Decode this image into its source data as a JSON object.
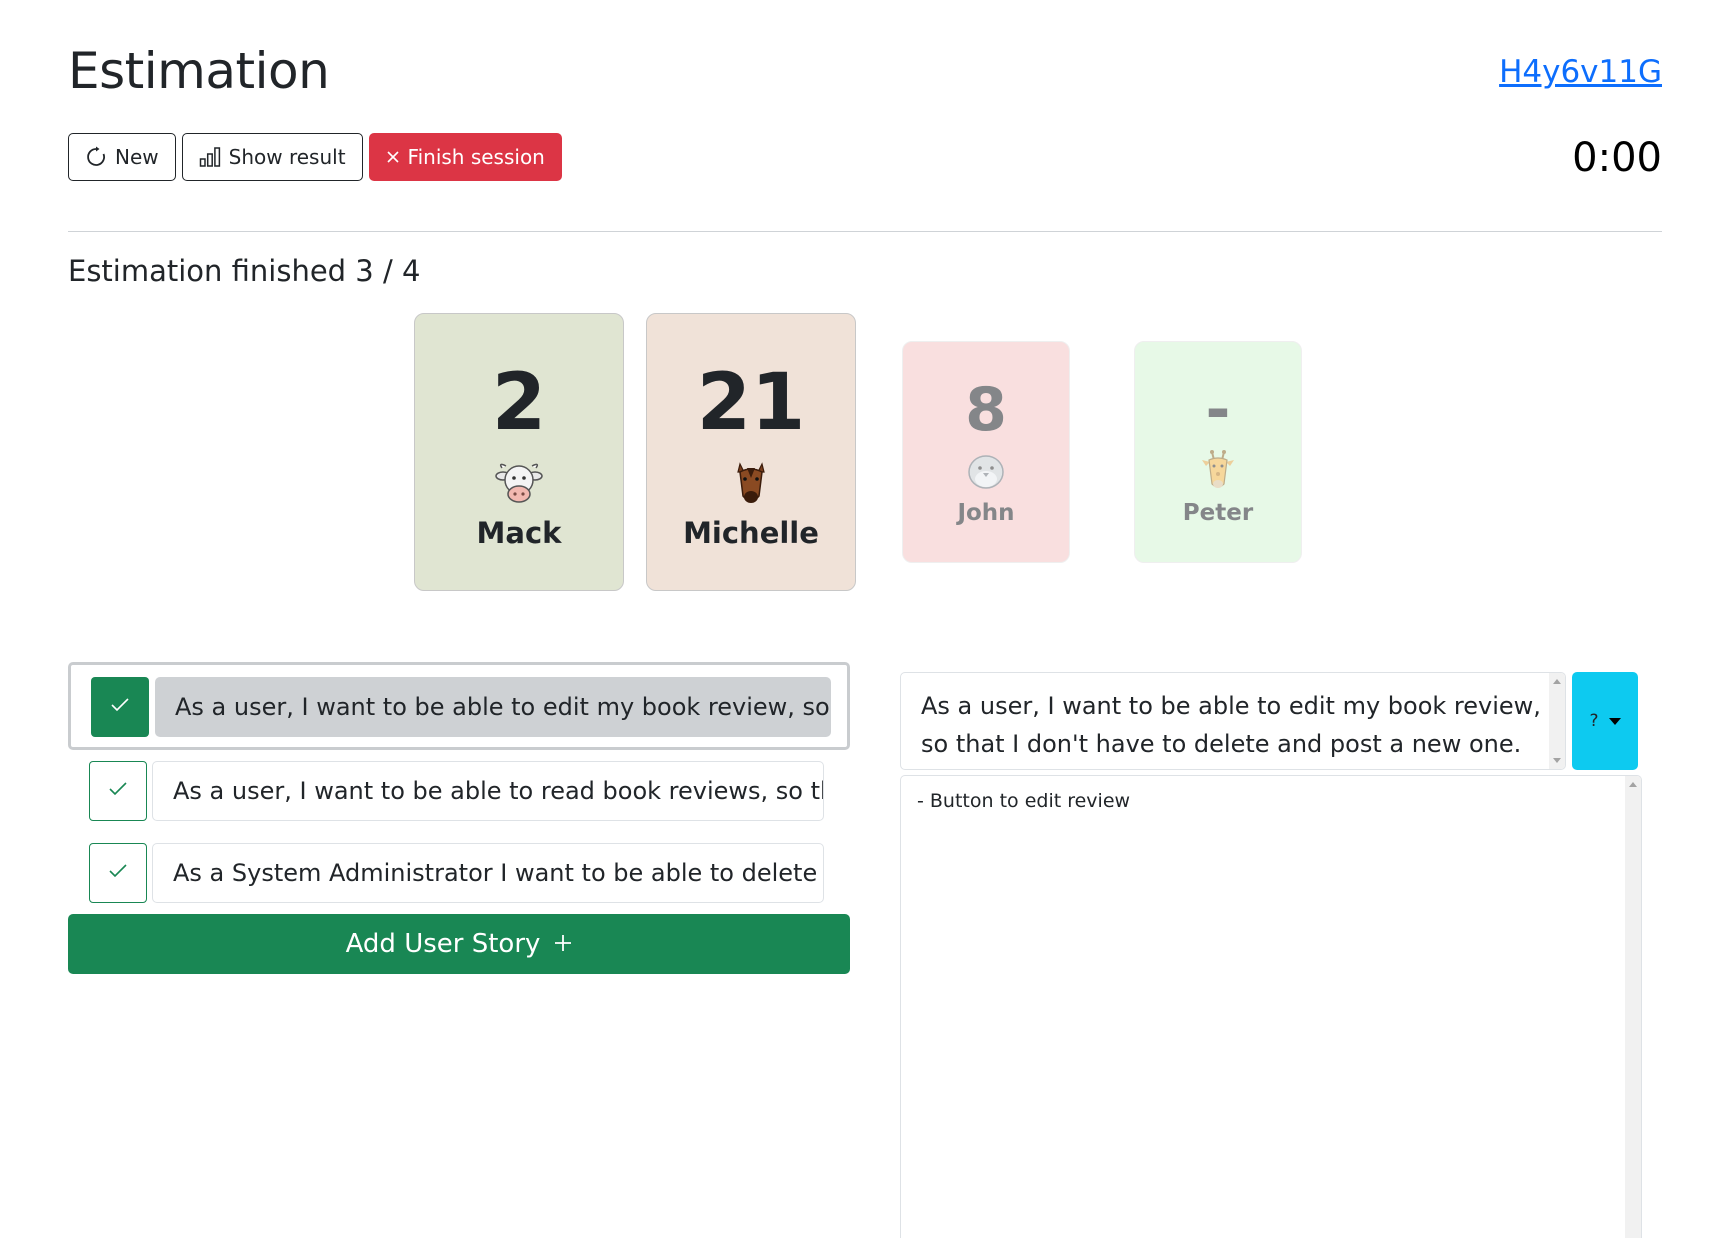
{
  "header": {
    "title": "Estimation",
    "session_id": "H4y6v11G",
    "timer": "0:00"
  },
  "toolbar": {
    "new_label": "New",
    "show_result_label": "Show result",
    "finish_label": "Finish session"
  },
  "status": {
    "heading": "Estimation finished 3 / 4"
  },
  "participants": [
    {
      "value": "2",
      "name": "Mack",
      "avatar": "cow-icon",
      "card_color": "#e0e5d2",
      "revealed": true
    },
    {
      "value": "21",
      "name": "Michelle",
      "avatar": "horse-icon",
      "card_color": "#f0e2d8",
      "revealed": true
    },
    {
      "value": "8",
      "name": "John",
      "avatar": "bird-icon",
      "card_color": "#f5c6c6",
      "revealed": false
    },
    {
      "value": "-",
      "name": "Peter",
      "avatar": "giraffe-icon",
      "card_color": "#d4f5d4",
      "revealed": false
    }
  ],
  "stories": [
    {
      "text": "As a user, I want to be able to edit my book review, so th",
      "active": true
    },
    {
      "text": "As a user, I want to be able to read book reviews, so that",
      "active": false
    },
    {
      "text": "As a System Administrator I want to be able to delete anc",
      "active": false
    }
  ],
  "add_story_label": "Add User Story",
  "detail": {
    "title": "As a user, I want to be able to edit my book review, so that I don't have to delete and post a new one.",
    "estimate": "?",
    "description": "- Button to edit review"
  },
  "colors": {
    "primary_link": "#0d6efd",
    "success": "#198754",
    "danger": "#dc3545",
    "info": "#0dcaf0"
  }
}
